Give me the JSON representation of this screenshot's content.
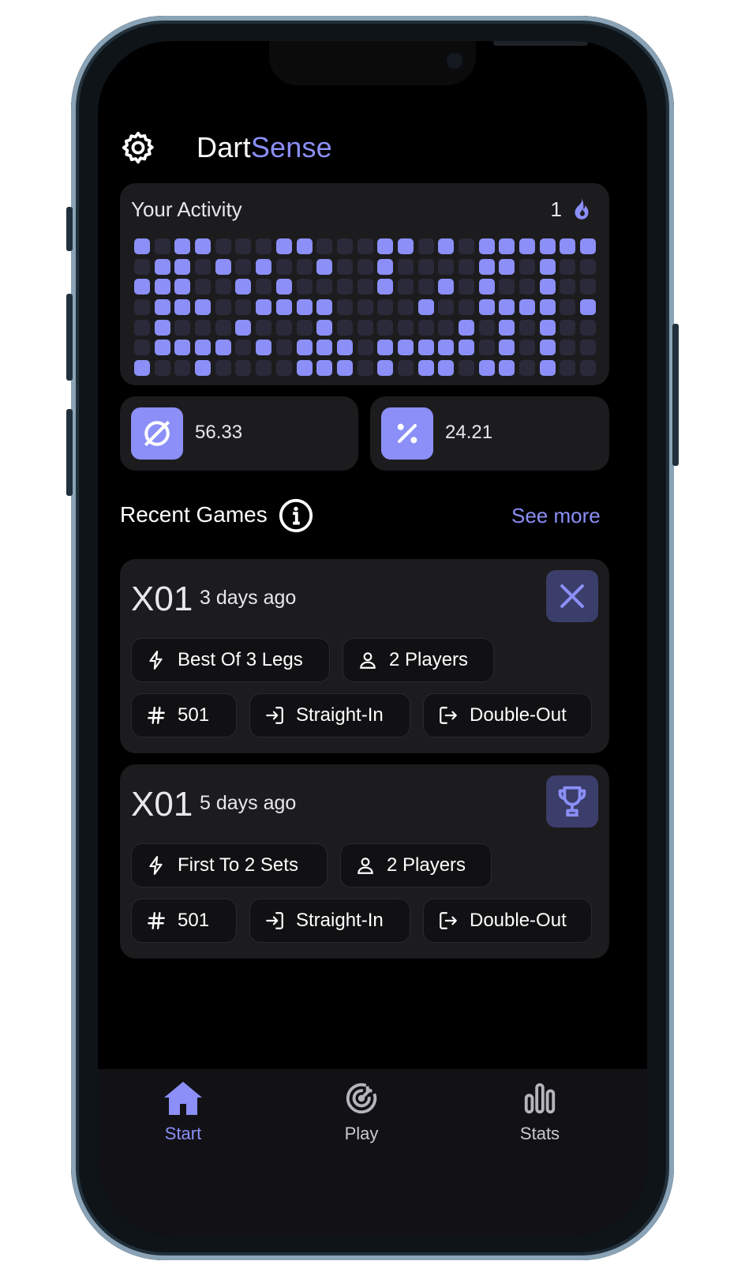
{
  "app": {
    "brand_prefix": "Dart",
    "brand_accent": "Sense",
    "accent_color": "#8b8ff7"
  },
  "activity": {
    "title": "Your Activity",
    "streak": "1",
    "streak_icon": "flame-icon",
    "rows": [
      [
        1,
        0,
        1,
        1,
        0,
        0,
        0,
        1,
        1,
        0,
        0,
        0,
        1,
        1,
        0,
        1,
        0,
        1,
        1,
        1,
        1,
        1,
        1
      ],
      [
        0,
        1,
        1,
        0,
        1,
        0,
        1,
        0,
        0,
        1,
        0,
        0,
        1,
        0,
        0,
        0,
        0,
        1,
        1,
        0,
        1,
        0,
        0
      ],
      [
        1,
        1,
        1,
        0,
        0,
        1,
        0,
        1,
        0,
        0,
        0,
        0,
        1,
        0,
        0,
        1,
        0,
        1,
        0,
        0,
        1,
        0,
        0
      ],
      [
        0,
        1,
        1,
        1,
        0,
        0,
        1,
        1,
        1,
        1,
        0,
        0,
        0,
        0,
        1,
        0,
        0,
        1,
        1,
        1,
        1,
        0,
        1
      ],
      [
        0,
        1,
        0,
        0,
        0,
        1,
        0,
        0,
        0,
        1,
        0,
        0,
        0,
        0,
        0,
        0,
        1,
        0,
        1,
        0,
        1,
        0,
        0
      ],
      [
        0,
        1,
        1,
        1,
        1,
        0,
        1,
        0,
        1,
        1,
        1,
        0,
        1,
        1,
        1,
        1,
        1,
        0,
        1,
        0,
        1,
        0,
        0
      ],
      [
        1,
        0,
        0,
        1,
        0,
        0,
        0,
        0,
        1,
        1,
        1,
        0,
        1,
        0,
        1,
        1,
        0,
        1,
        1,
        0,
        1,
        0,
        0
      ]
    ]
  },
  "stats": {
    "average": {
      "value": "56.33",
      "icon": "diameter-icon"
    },
    "checkout": {
      "value": "24.21",
      "icon": "percent-icon"
    }
  },
  "recent": {
    "title": "Recent Games",
    "see_more": "See more"
  },
  "games": [
    {
      "type": "X01",
      "date": "3 days ago",
      "result_icon": "close-icon",
      "chips": {
        "format": "Best Of 3 Legs",
        "players": "2 Players",
        "score": "501",
        "in": "Straight-In",
        "out": "Double-Out"
      }
    },
    {
      "type": "X01",
      "date": "5 days ago",
      "result_icon": "trophy-icon",
      "chips": {
        "format": "First To 2 Sets",
        "players": "2 Players",
        "score": "501",
        "in": "Straight-In",
        "out": "Double-Out"
      }
    }
  ],
  "nav": {
    "start": "Start",
    "play": "Play",
    "stats": "Stats",
    "active": "start"
  }
}
